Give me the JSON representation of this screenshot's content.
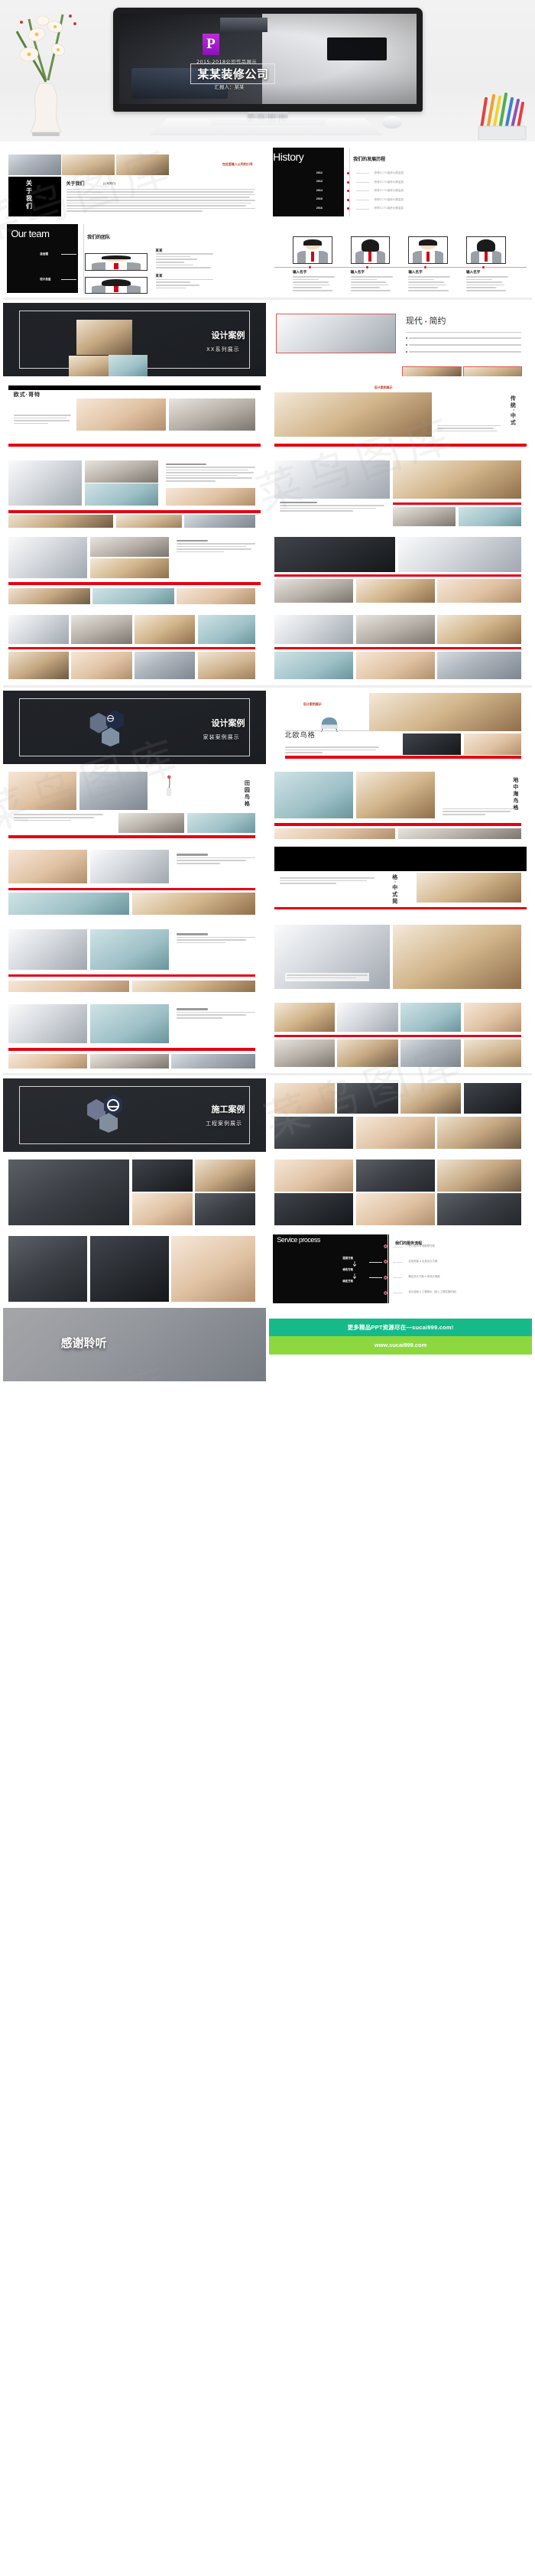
{
  "hero": {
    "badge": "P",
    "subtitle": "2015-2018公司作品展示",
    "title": "某某装修公司",
    "presenter": "汇报人：某某",
    "brand": "菜鸟图库"
  },
  "slides": {
    "about": {
      "slogan": "在这里输入公司的口号",
      "vertical_title": "关于我们",
      "heading": "关于我们",
      "heading_note": "(公司简介)",
      "body": "某某签约原创设计师作品，盗卖者将被追究知识产权的法律责任，请勿以身试法！"
    },
    "history": {
      "en_title": "History",
      "heading": "我们的发展历程",
      "items": [
        {
          "year": "2012",
          "text": "获得CCTV装修大赛金奖"
        },
        {
          "year": "2013",
          "text": "获得CCTV装修大赛金奖"
        },
        {
          "year": "2014",
          "text": "获得CCTV装修大赛金奖"
        },
        {
          "year": "2015",
          "text": "获得CCTV装修大赛金奖"
        },
        {
          "year": "2016",
          "text": "获得CCTV装修大赛金奖"
        }
      ]
    },
    "team": {
      "en_title": "Our team",
      "heading": "我们的团队",
      "roles": [
        "总经理",
        "设计总监"
      ],
      "member_name": "某某",
      "member_lines": [
        "某某签约原创设计师作品",
        "个人发展历程",
        "曾经供职过某某",
        "服务过某某",
        "基本的项目经验",
        "某某签约原创设计师作品"
      ]
    },
    "team_grid": {
      "name": "输入名字",
      "lines": [
        "某某签约原创设计师",
        "个人发展历程",
        "曾经供职过的公司",
        "服务过哪些大品牌",
        "基本的项目经验",
        "个人打算本规点是积淀"
      ]
    },
    "case_cover": {
      "title": "设计案例",
      "subtitle": "XX系列展示"
    },
    "modern": {
      "title_a": "现代",
      "dot": "•",
      "title_b": "简约",
      "bullets": [
        "某某签约原创设计师作品，盗卖者将被追究知识产权的法律责任，请勿以身试法！",
        "某某签约原创设计师作品，盗卖者将被追究知识产权的法律责任，请勿以身试法！",
        "某某签约原创设计师作品，盗卖者将被追究知识产权的法律责任，请勿以身试法！"
      ]
    },
    "tag_case_show": "设计案例展示",
    "euro": {
      "title": "欧式·哥特"
    },
    "chinese": {
      "title": "传统·中式"
    },
    "nordic": {
      "title": "北欧鸟格",
      "body": "格，是指时尚的国家装潢风格。丹麦、瑞典、芬兰及冰岛等国的艺术设计风格。这都包含在北欧风格中，其中芬兰的设计更加注重实用，\"简约主义\"、\"民族化\"等。"
    },
    "pastoral": {
      "title": "田园鸟格"
    },
    "mediterranean": {
      "title": "地中海鸟格"
    },
    "newchinese": {
      "title": "格·中式简"
    },
    "home_cover": {
      "title": "设计案例",
      "subtitle": "家装案例展示"
    },
    "construction_cover": {
      "title": "施工案例",
      "subtitle": "工程案例展示"
    },
    "service": {
      "en_title": "Service process",
      "heading": "我们的服务流程",
      "flow": [
        "提报方案",
        "修改方案",
        "确定方案"
      ],
      "items": [
        "签订合同 & 收取预付款",
        "实地测量 & 出具设计方案",
        "确定设计方案 & 收设计尾款",
        "设计结案 & 工程报价（进入工程实施阶段）"
      ]
    },
    "thanks": {
      "title": "感谢聆听"
    }
  },
  "footer": {
    "line1": "更多精品PPT资源尽在—sucai999.com!",
    "line2": "www.sucai999.com"
  },
  "colors": {
    "accent_red": "#e60012",
    "dark": "#0a0a0a",
    "teal": "#16b98a",
    "green": "#8dd83e"
  }
}
